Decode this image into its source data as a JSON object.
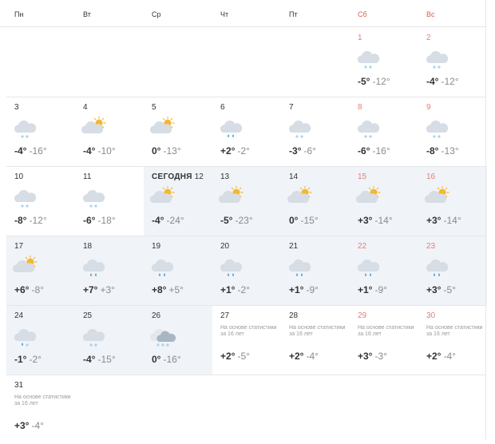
{
  "weekdays": [
    {
      "label": "Пн",
      "weekend": false
    },
    {
      "label": "Вт",
      "weekend": false
    },
    {
      "label": "Ср",
      "weekend": false
    },
    {
      "label": "Чт",
      "weekend": false
    },
    {
      "label": "Пт",
      "weekend": false
    },
    {
      "label": "Сб",
      "weekend": true
    },
    {
      "label": "Вс",
      "weekend": true
    }
  ],
  "today_label": "СЕГОДНЯ",
  "stat_note": "На основе статистики за 16 лет",
  "colors": {
    "weekend": "#e05a4f",
    "shade": "#f0f3f7",
    "cloud": "#d6dde4",
    "sun": "#f5b731",
    "rain": "#4aa3d8",
    "snow": "#a8d4ee"
  },
  "days": [
    {
      "day": "1",
      "col": 5,
      "row": 0,
      "icon": "cloud-snow-icon",
      "max": "-5°",
      "min": "-12°",
      "shade": false
    },
    {
      "day": "2",
      "col": 6,
      "row": 0,
      "icon": "cloud-snow-icon",
      "max": "-4°",
      "min": "-12°",
      "shade": false
    },
    {
      "day": "3",
      "col": 0,
      "row": 1,
      "icon": "cloud-snow-icon",
      "max": "-4°",
      "min": "-16°",
      "shade": false
    },
    {
      "day": "4",
      "col": 1,
      "row": 1,
      "icon": "partly-cloudy-icon",
      "max": "-4°",
      "min": "-10°",
      "shade": false
    },
    {
      "day": "5",
      "col": 2,
      "row": 1,
      "icon": "partly-cloudy-icon",
      "max": "0°",
      "min": "-13°",
      "shade": false
    },
    {
      "day": "6",
      "col": 3,
      "row": 1,
      "icon": "cloud-rain-icon",
      "max": "+2°",
      "min": "-2°",
      "shade": false
    },
    {
      "day": "7",
      "col": 4,
      "row": 1,
      "icon": "cloud-snow-icon",
      "max": "-3°",
      "min": "-6°",
      "shade": false
    },
    {
      "day": "8",
      "col": 5,
      "row": 1,
      "icon": "cloud-snow-icon",
      "max": "-6°",
      "min": "-16°",
      "shade": false
    },
    {
      "day": "9",
      "col": 6,
      "row": 1,
      "icon": "cloud-snow-icon",
      "max": "-8°",
      "min": "-13°",
      "shade": false
    },
    {
      "day": "10",
      "col": 0,
      "row": 2,
      "icon": "cloud-snow-icon",
      "max": "-8°",
      "min": "-12°",
      "shade": false
    },
    {
      "day": "11",
      "col": 1,
      "row": 2,
      "icon": "cloud-snow-icon",
      "max": "-6°",
      "min": "-18°",
      "shade": false
    },
    {
      "day": "12",
      "col": 2,
      "row": 2,
      "icon": "partly-cloudy-icon",
      "max": "-4°",
      "min": "-24°",
      "shade": true,
      "today": true
    },
    {
      "day": "13",
      "col": 3,
      "row": 2,
      "icon": "partly-cloudy-icon",
      "max": "-5°",
      "min": "-23°",
      "shade": true
    },
    {
      "day": "14",
      "col": 4,
      "row": 2,
      "icon": "partly-cloudy-icon",
      "max": "0°",
      "min": "-15°",
      "shade": true
    },
    {
      "day": "15",
      "col": 5,
      "row": 2,
      "icon": "partly-cloudy-icon",
      "max": "+3°",
      "min": "-14°",
      "shade": true
    },
    {
      "day": "16",
      "col": 6,
      "row": 2,
      "icon": "partly-cloudy-icon",
      "max": "+3°",
      "min": "-14°",
      "shade": true
    },
    {
      "day": "17",
      "col": 0,
      "row": 3,
      "icon": "partly-cloudy-icon",
      "max": "+6°",
      "min": "-8°",
      "shade": true
    },
    {
      "day": "18",
      "col": 1,
      "row": 3,
      "icon": "cloud-rain-icon",
      "max": "+7°",
      "min": "+3°",
      "shade": true
    },
    {
      "day": "19",
      "col": 2,
      "row": 3,
      "icon": "cloud-rain-icon",
      "max": "+8°",
      "min": "+5°",
      "shade": true
    },
    {
      "day": "20",
      "col": 3,
      "row": 3,
      "icon": "cloud-rain-icon",
      "max": "+1°",
      "min": "-2°",
      "shade": true
    },
    {
      "day": "21",
      "col": 4,
      "row": 3,
      "icon": "cloud-rain-icon",
      "max": "+1°",
      "min": "-9°",
      "shade": true
    },
    {
      "day": "22",
      "col": 5,
      "row": 3,
      "icon": "cloud-rain-icon",
      "max": "+1°",
      "min": "-9°",
      "shade": true
    },
    {
      "day": "23",
      "col": 6,
      "row": 3,
      "icon": "cloud-rain-icon",
      "max": "+3°",
      "min": "-5°",
      "shade": true
    },
    {
      "day": "24",
      "col": 0,
      "row": 4,
      "icon": "cloud-rain-snow-icon",
      "max": "-1°",
      "min": "-2°",
      "shade": true
    },
    {
      "day": "25",
      "col": 1,
      "row": 4,
      "icon": "cloud-snow-icon",
      "max": "-4°",
      "min": "-15°",
      "shade": true
    },
    {
      "day": "26",
      "col": 2,
      "row": 4,
      "icon": "heavy-snow-icon",
      "max": "0°",
      "min": "-16°",
      "shade": true
    },
    {
      "day": "27",
      "col": 3,
      "row": 4,
      "stat": true,
      "max": "+2°",
      "min": "-5°",
      "shade": false
    },
    {
      "day": "28",
      "col": 4,
      "row": 4,
      "stat": true,
      "max": "+2°",
      "min": "-4°",
      "shade": false
    },
    {
      "day": "29",
      "col": 5,
      "row": 4,
      "stat": true,
      "max": "+3°",
      "min": "-3°",
      "shade": false
    },
    {
      "day": "30",
      "col": 6,
      "row": 4,
      "stat": true,
      "max": "+2°",
      "min": "-4°",
      "shade": false
    },
    {
      "day": "31",
      "col": 0,
      "row": 5,
      "stat": true,
      "max": "+3°",
      "min": "-4°",
      "shade": false
    }
  ]
}
